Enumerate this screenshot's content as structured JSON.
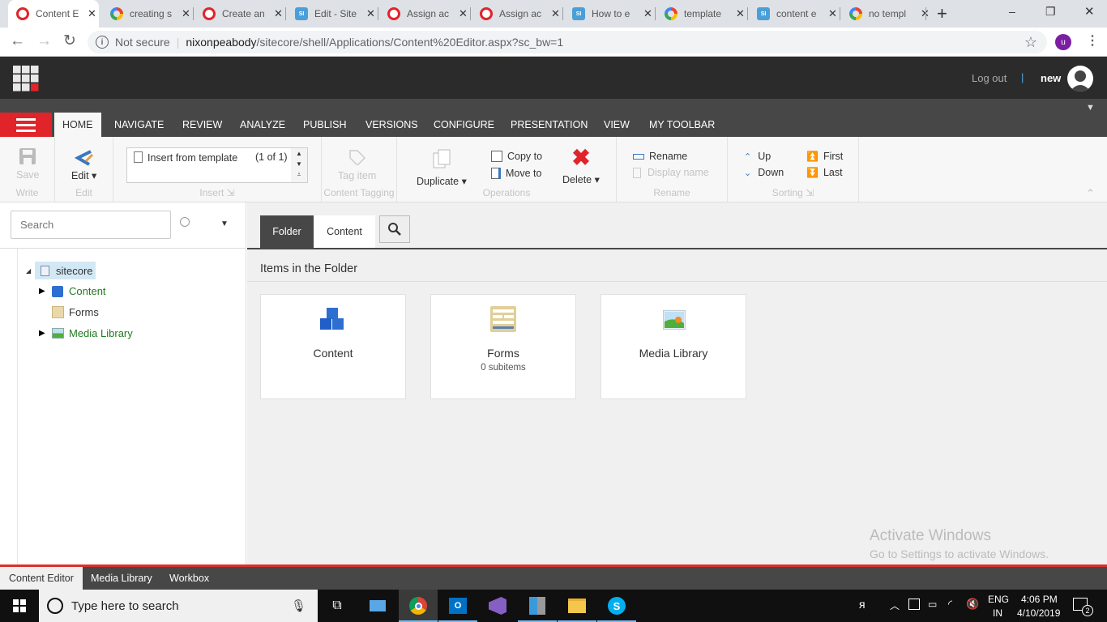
{
  "browser": {
    "tabs": [
      {
        "title": "Content E",
        "favicon": "opera-icon",
        "active": true
      },
      {
        "title": "creating s",
        "favicon": "google-icon"
      },
      {
        "title": "Create an",
        "favicon": "opera-icon"
      },
      {
        "title": "Edit - Site",
        "favicon": "sitecore-si-icon"
      },
      {
        "title": "Assign ac",
        "favicon": "opera-icon"
      },
      {
        "title": "Assign ac",
        "favicon": "opera-icon"
      },
      {
        "title": "How to e",
        "favicon": "sitecore-si-icon"
      },
      {
        "title": "template",
        "favicon": "google-icon"
      },
      {
        "title": "content e",
        "favicon": "sitecore-si-icon"
      },
      {
        "title": "no templ",
        "favicon": "google-icon"
      }
    ],
    "new_tab": "+",
    "window_controls": {
      "minimize": "–",
      "restore": "❐",
      "close": "✕"
    },
    "security": "Not secure",
    "url_host": "nixonpeabody",
    "url_path": "/sitecore/shell/Applications/Content%20Editor.aspx?sc_bw=1",
    "profile_initial": "u",
    "profile_color": "#7b1fa2"
  },
  "header": {
    "logout": "Log out",
    "separator": "|",
    "username": "new"
  },
  "ribbon_tabs": [
    "HOME",
    "NAVIGATE",
    "REVIEW",
    "ANALYZE",
    "PUBLISH",
    "VERSIONS",
    "CONFIGURE",
    "PRESENTATION",
    "VIEW",
    "MY TOOLBAR"
  ],
  "ribbon": {
    "write": {
      "label": "Write",
      "save": "Save"
    },
    "edit": {
      "label": "Edit",
      "edit": "Edit"
    },
    "insert": {
      "label": "Insert",
      "item": "Insert from template",
      "count": "(1 of 1)"
    },
    "tagging": {
      "label": "Content Tagging",
      "tag": "Tag item"
    },
    "operations": {
      "label": "Operations",
      "duplicate": "Duplicate",
      "copy": "Copy to",
      "move": "Move to",
      "delete": "Delete"
    },
    "rename": {
      "label": "Rename",
      "rename": "Rename",
      "display_name": "Display name"
    },
    "sorting": {
      "label": "Sorting",
      "up": "Up",
      "down": "Down",
      "first": "First",
      "last": "Last"
    }
  },
  "search": {
    "placeholder": "Search"
  },
  "tree": {
    "root": "sitecore",
    "children": [
      {
        "label": "Content",
        "expandable": true
      },
      {
        "label": "Forms",
        "expandable": false
      },
      {
        "label": "Media Library",
        "expandable": true
      }
    ]
  },
  "main": {
    "tabs": [
      "Folder",
      "Content"
    ],
    "heading": "Items in the Folder",
    "cards": [
      {
        "title": "Content",
        "subtitle": ""
      },
      {
        "title": "Forms",
        "subtitle": "0 subitems"
      },
      {
        "title": "Media Library",
        "subtitle": ""
      }
    ],
    "watermark_title": "Activate Windows",
    "watermark_sub": "Go to Settings to activate Windows."
  },
  "bottom_tabs": [
    "Content Editor",
    "Media Library",
    "Workbox"
  ],
  "taskbar": {
    "search_placeholder": "Type here to search",
    "lang1": "ENG",
    "lang2": "IN",
    "time": "4:06 PM",
    "date": "4/10/2019",
    "notifications": "2"
  }
}
